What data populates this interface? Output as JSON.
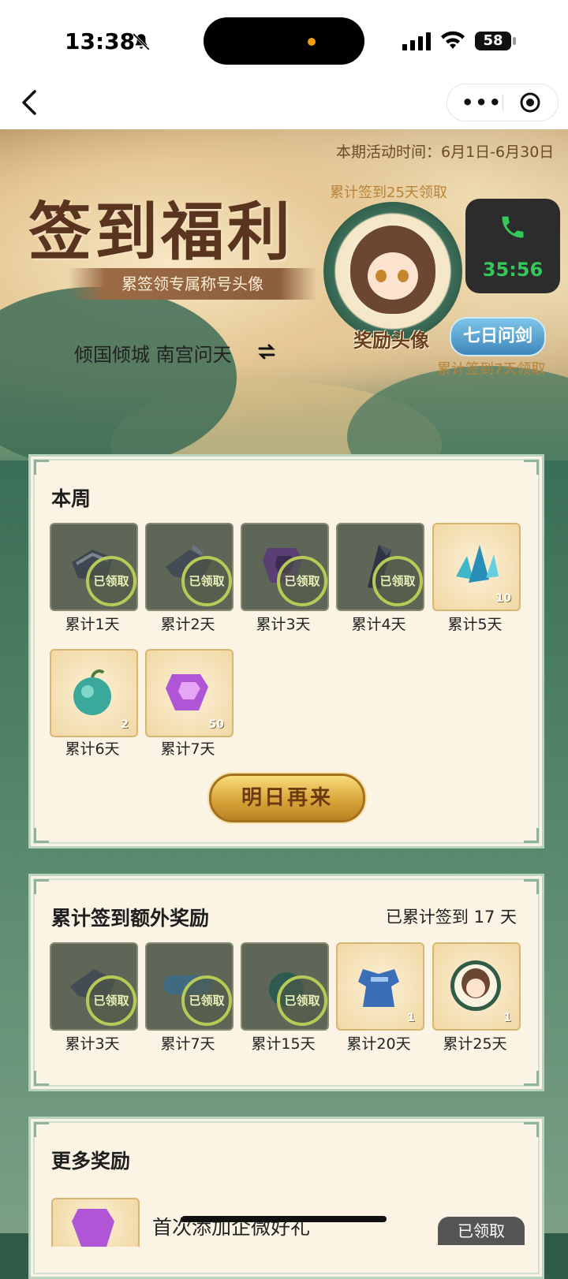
{
  "status": {
    "time": "13:38",
    "battery": "58"
  },
  "nav": {
    "more": "•••"
  },
  "banner": {
    "period": "本期活动时间：6月1日-6月30日",
    "title": "签到福利",
    "subtitle": "累签领专属称号头像",
    "player": "倾国倾城 南宫问天",
    "cum25": "累计签到25天领取",
    "avatar_label": "奖励头像",
    "title_badge": "七日问剑",
    "cum7": "累计签到7天领取"
  },
  "call": {
    "duration": "35:56"
  },
  "week": {
    "title": "本周",
    "items": [
      {
        "label": "累计1天",
        "stamp": "已领取",
        "qty": ""
      },
      {
        "label": "累计2天",
        "stamp": "已领取",
        "qty": ""
      },
      {
        "label": "累计3天",
        "stamp": "已领取",
        "qty": ""
      },
      {
        "label": "累计4天",
        "stamp": "已领取",
        "qty": ""
      },
      {
        "label": "累计5天",
        "stamp": "",
        "qty": "10"
      },
      {
        "label": "累计6天",
        "stamp": "",
        "qty": "2"
      },
      {
        "label": "累计7天",
        "stamp": "",
        "qty": "50"
      }
    ],
    "button": "明日再来"
  },
  "extra": {
    "title": "累计签到额外奖励",
    "count_text": "已累计签到 17 天",
    "items": [
      {
        "label": "累计3天",
        "stamp": "已领取",
        "qty": ""
      },
      {
        "label": "累计7天",
        "stamp": "已领取",
        "qty": ""
      },
      {
        "label": "累计15天",
        "stamp": "已领取",
        "qty": ""
      },
      {
        "label": "累计20天",
        "stamp": "",
        "qty": "1"
      },
      {
        "label": "累计25天",
        "stamp": "",
        "qty": "1"
      }
    ]
  },
  "more": {
    "title": "更多奖励",
    "first_item": "首次添加企微好礼",
    "first_button": "已领取"
  },
  "colors": {
    "accent_gold": "#d8a53a",
    "card_bg": "#fbf4e4",
    "green_bg": "#3d7058",
    "call_green": "#34c759"
  }
}
